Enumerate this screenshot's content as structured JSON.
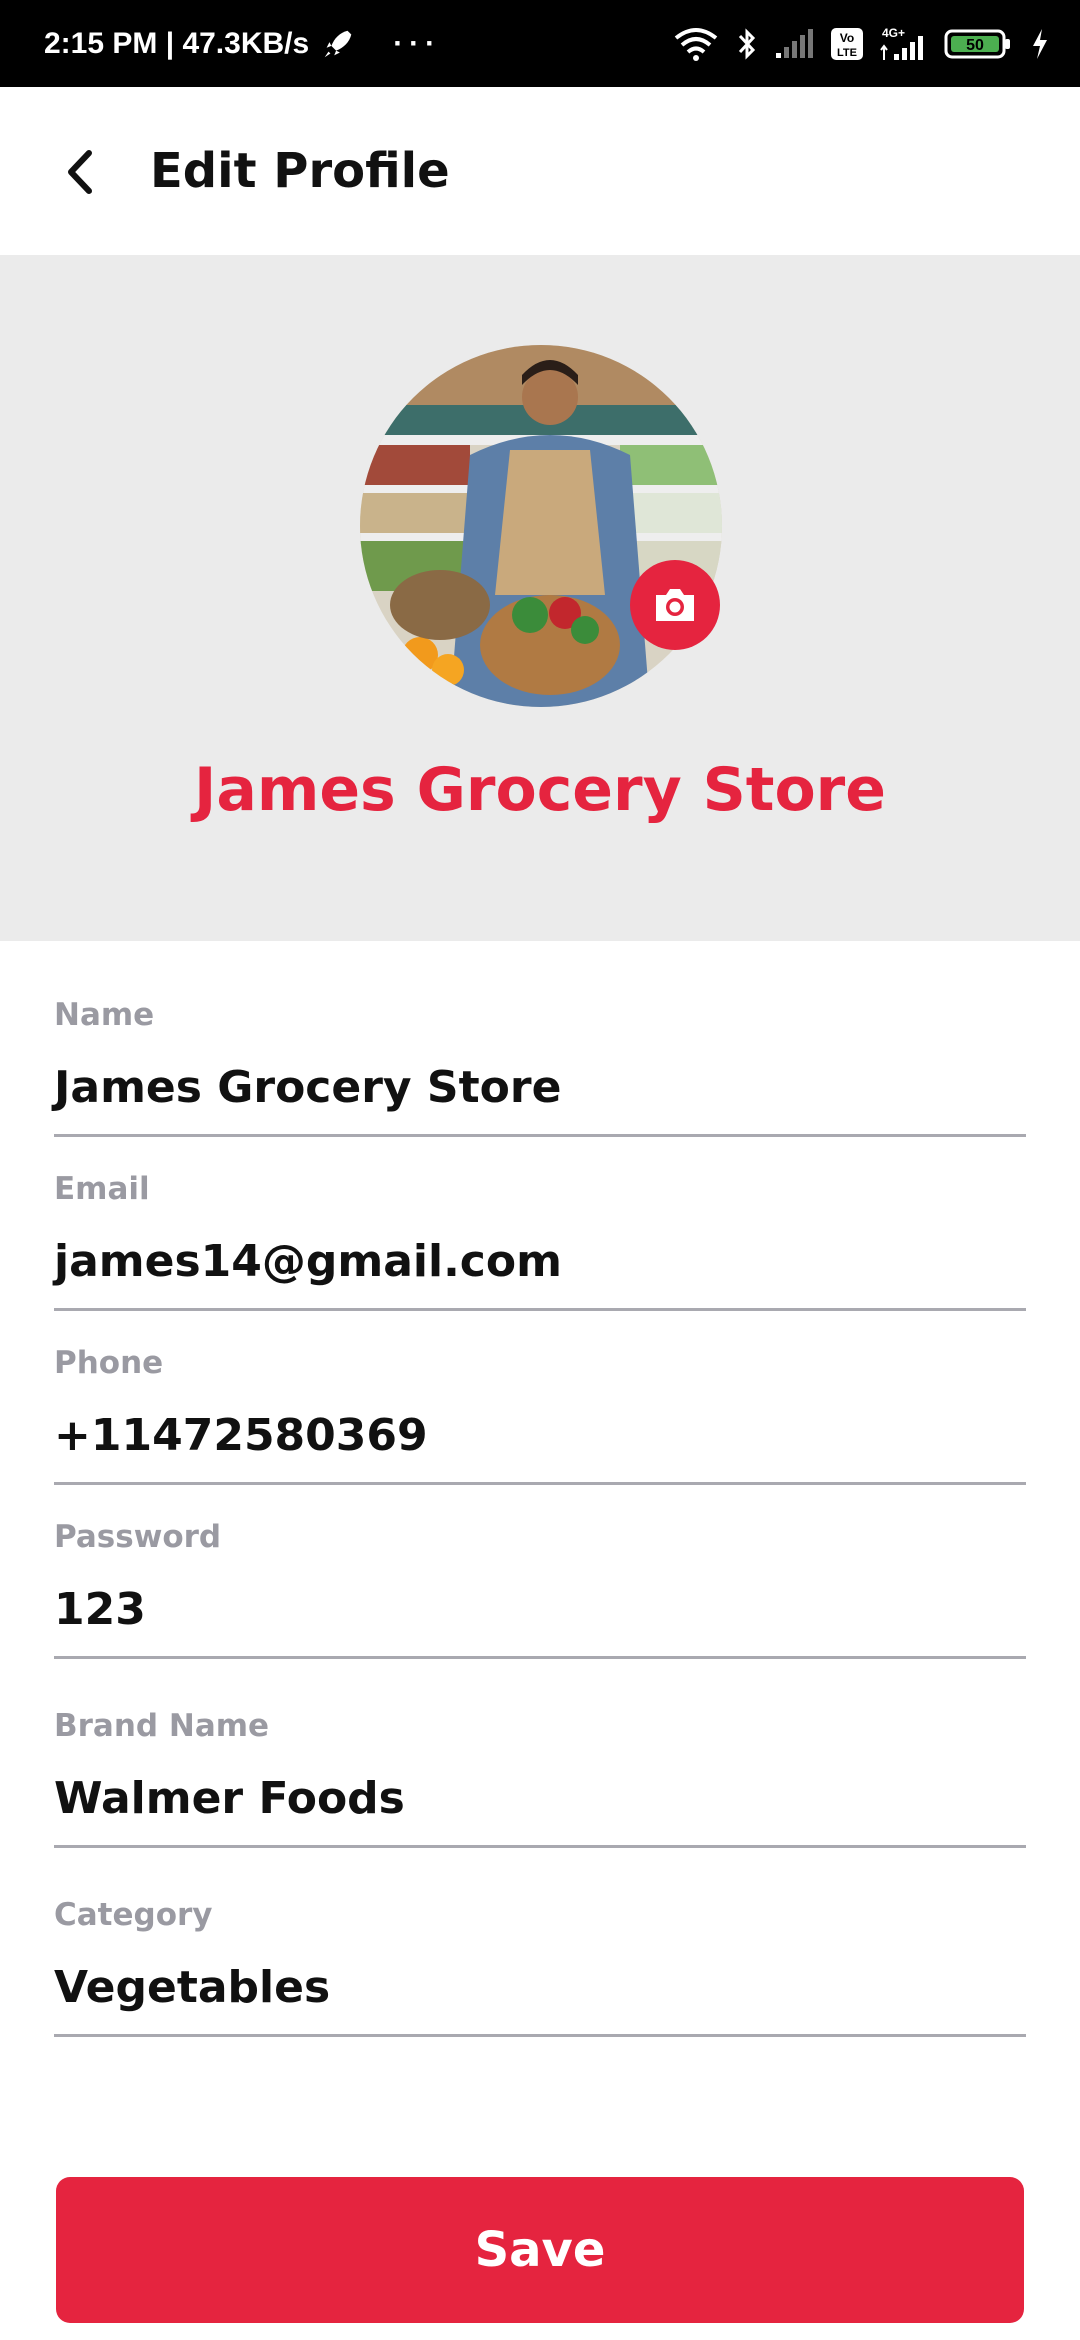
{
  "status_bar": {
    "time_and_speed": "2:15 PM | 47.3KB/s",
    "more": "···",
    "network_badge": "4G+",
    "volte_line1": "Vo",
    "volte_line2": "LTE",
    "battery_level": "50"
  },
  "header": {
    "title": "Edit Profile",
    "back_icon": "back-arrow-icon"
  },
  "profile": {
    "store_name": "James Grocery Store",
    "camera_icon": "camera-icon"
  },
  "form": {
    "fields": [
      {
        "label": "Name",
        "value": "James Grocery Store"
      },
      {
        "label": "Email",
        "value": "james14@gmail.com"
      },
      {
        "label": "Phone",
        "value": "+11472580369"
      },
      {
        "label": "Password",
        "value": "123"
      },
      {
        "label": "Brand Name",
        "value": "Walmer Foods"
      },
      {
        "label": "Category",
        "value": "Vegetables"
      }
    ]
  },
  "actions": {
    "save_label": "Save"
  },
  "colors": {
    "accent": "#e5243f",
    "header_bg": "#ebebeb",
    "label_gray": "#9a9aa2"
  }
}
